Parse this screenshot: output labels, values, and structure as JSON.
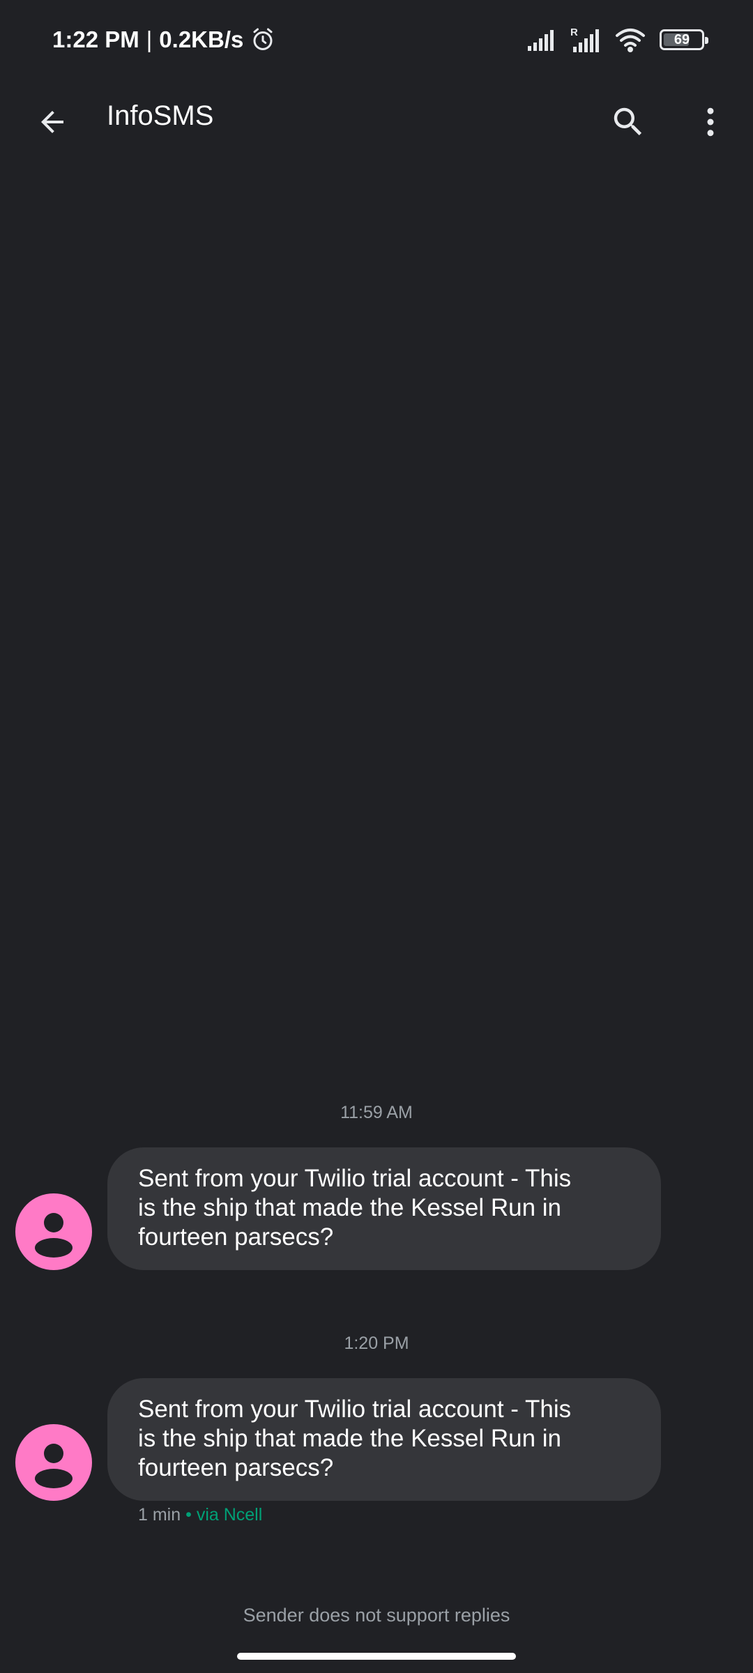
{
  "status_bar": {
    "time": "1:22 PM",
    "separator": "|",
    "speed": "0.2KB/s",
    "battery": "69",
    "battery_level": 0.69,
    "icons": [
      "alarm-icon",
      "signal-icon",
      "roaming-signal-icon",
      "wifi-icon",
      "battery-icon"
    ]
  },
  "app_bar": {
    "title": "InfoSMS",
    "icons": [
      "back-arrow-icon",
      "search-icon",
      "more-vert-icon"
    ]
  },
  "messages": [
    {
      "timestamp": "11:59 AM",
      "text": "Sent from your Twilio trial account - This is the ship that made the Kessel Run in fourteen parsecs?"
    },
    {
      "timestamp": "1:20 PM",
      "text": "Sent from your Twilio trial account - This is the ship that made the Kessel Run in fourteen parsecs?",
      "meta_time": "1 min",
      "meta_dot": "•",
      "meta_via": "via Ncell"
    }
  ],
  "footer": {
    "note": "Sender does not support replies"
  },
  "colors": {
    "background": "#202125",
    "bubble": "#35363a",
    "avatar": "#ff7ac6",
    "via_accent": "#00a076"
  }
}
